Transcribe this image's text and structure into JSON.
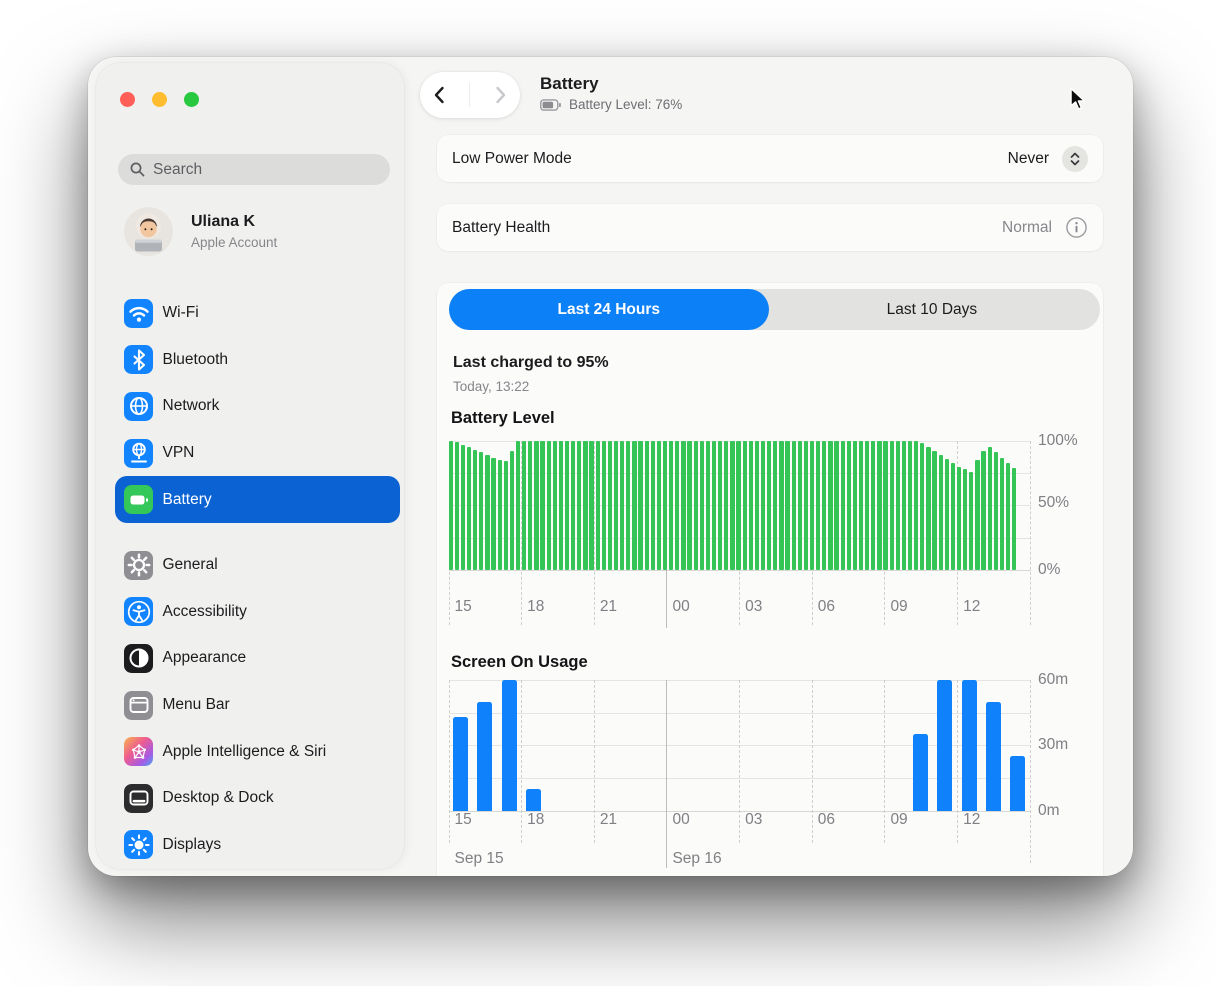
{
  "window": {
    "traffic_lights": [
      "close",
      "minimize",
      "zoom"
    ]
  },
  "sidebar": {
    "search_placeholder": "Search",
    "account": {
      "name": "Uliana K",
      "subtitle": "Apple Account"
    },
    "nav_primary": [
      {
        "label": "Wi-Fi",
        "icon": "wifi",
        "selected": false
      },
      {
        "label": "Bluetooth",
        "icon": "bluetooth",
        "selected": false
      },
      {
        "label": "Network",
        "icon": "network",
        "selected": false
      },
      {
        "label": "VPN",
        "icon": "vpn",
        "selected": false
      },
      {
        "label": "Battery",
        "icon": "battery",
        "selected": true
      }
    ],
    "nav_secondary": [
      {
        "label": "General",
        "icon": "general",
        "selected": false
      },
      {
        "label": "Accessibility",
        "icon": "accessibility",
        "selected": false
      },
      {
        "label": "Appearance",
        "icon": "appearance",
        "selected": false
      },
      {
        "label": "Menu Bar",
        "icon": "menubar",
        "selected": false
      },
      {
        "label": "Apple Intelligence & Siri",
        "icon": "ai-siri",
        "selected": false
      },
      {
        "label": "Desktop & Dock",
        "icon": "desktop-dock",
        "selected": false
      },
      {
        "label": "Displays",
        "icon": "displays",
        "selected": false
      }
    ]
  },
  "header": {
    "title": "Battery",
    "subtitle": "Battery Level: 76%"
  },
  "settings_rows": [
    {
      "label": "Low Power Mode",
      "value": "Never",
      "control": "stepper"
    },
    {
      "label": "Battery Health",
      "value": "Normal",
      "control": "info"
    }
  ],
  "usage_panel": {
    "tabs": [
      {
        "label": "Last 24 Hours",
        "selected": true
      },
      {
        "label": "Last 10 Days",
        "selected": false
      }
    ],
    "last_charged": "Last charged to 95%",
    "last_charged_time": "Today, 13:22"
  },
  "colors": {
    "sidebar_selection": "#0b63d3",
    "segment_accent": "#0c80f6",
    "battery_bar_green": "#35c456",
    "screen_bar_blue": "#0f82fb"
  },
  "chart_data": [
    {
      "type": "bar",
      "title": "Battery Level",
      "unit": "%",
      "ylim": [
        0,
        100
      ],
      "y_tick_labels": [
        "100%",
        "50%",
        "0%"
      ],
      "x_tick_labels": [
        "15",
        "18",
        "21",
        "00",
        "03",
        "06",
        "09",
        "12"
      ],
      "x_solid_tick": "00",
      "x_start_hour": 15,
      "interval_minutes": 15,
      "bar_color": "#35c456",
      "values": [
        100,
        99,
        97,
        95,
        93,
        91,
        89,
        87,
        85,
        84,
        92,
        100,
        100,
        100,
        100,
        100,
        100,
        100,
        100,
        100,
        100,
        100,
        100,
        100,
        100,
        100,
        100,
        100,
        100,
        100,
        100,
        100,
        100,
        100,
        100,
        100,
        100,
        100,
        100,
        100,
        100,
        100,
        100,
        100,
        100,
        100,
        100,
        100,
        100,
        100,
        100,
        100,
        100,
        100,
        100,
        100,
        100,
        100,
        100,
        100,
        100,
        100,
        100,
        100,
        100,
        100,
        100,
        100,
        100,
        100,
        100,
        100,
        100,
        100,
        100,
        100,
        100,
        98,
        95,
        92,
        89,
        86,
        83,
        80,
        78,
        76,
        85,
        92,
        95,
        91,
        87,
        83,
        79
      ]
    },
    {
      "type": "bar",
      "title": "Screen On Usage",
      "unit": "m",
      "ylim": [
        0,
        60
      ],
      "y_tick_labels": [
        "60m",
        "30m",
        "0m"
      ],
      "x_tick_labels": [
        "15",
        "18",
        "21",
        "00",
        "03",
        "06",
        "09",
        "12"
      ],
      "x_solid_tick": "00",
      "x_start_hour": 15,
      "interval_minutes": 60,
      "bar_color": "#0f82fb",
      "date_labels": [
        {
          "text": "Sep 15",
          "tick_index": 0
        },
        {
          "text": "Sep 16",
          "tick_index": 3
        }
      ],
      "values": [
        43,
        50,
        60,
        10,
        0,
        0,
        0,
        0,
        0,
        0,
        0,
        0,
        0,
        0,
        0,
        0,
        0,
        0,
        0,
        35,
        60,
        60,
        50,
        25
      ]
    }
  ]
}
